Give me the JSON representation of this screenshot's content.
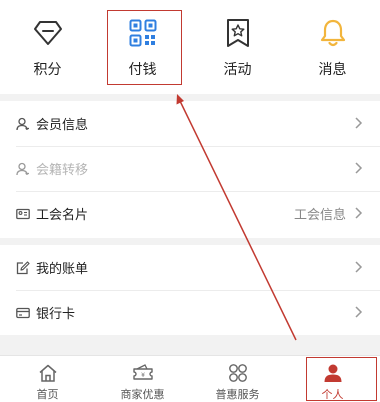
{
  "quick_actions": [
    {
      "label": "积分",
      "icon": "diamond-icon"
    },
    {
      "label": "付钱",
      "icon": "qr-code-icon"
    },
    {
      "label": "活动",
      "icon": "star-bookmark-icon"
    },
    {
      "label": "消息",
      "icon": "bell-icon"
    }
  ],
  "menu_group_1": [
    {
      "label": "会员信息",
      "icon": "user-icon",
      "value": ""
    },
    {
      "label": "会籍转移",
      "icon": "user-transfer-icon",
      "value": ""
    },
    {
      "label": "工会名片",
      "icon": "id-card-icon",
      "value": "工会信息"
    }
  ],
  "menu_group_2": [
    {
      "label": "我的账单",
      "icon": "bill-icon"
    },
    {
      "label": "银行卡",
      "icon": "bank-card-icon"
    }
  ],
  "tabbar": [
    {
      "label": "首页",
      "icon": "home-icon"
    },
    {
      "label": "商家优惠",
      "icon": "coupon-icon"
    },
    {
      "label": "普惠服务",
      "icon": "grid-services-icon"
    },
    {
      "label": "个人",
      "icon": "person-icon"
    }
  ],
  "colors": {
    "accent": "#c23a31",
    "qr_blue": "#2f7fe0",
    "bell_gold": "#f2b53c"
  }
}
